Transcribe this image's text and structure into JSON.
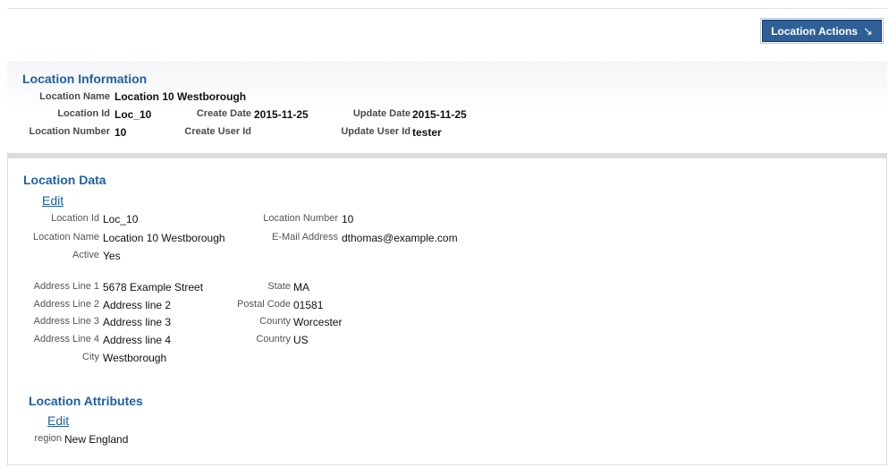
{
  "actions": {
    "label": "Location Actions",
    "icon": "arrow-down-right-icon"
  },
  "info": {
    "title": "Location Information",
    "location_name_label": "Location Name",
    "location_name": "Location 10 Westborough",
    "location_id_label": "Location Id",
    "location_id": "Loc_10",
    "create_date_label": "Create Date",
    "create_date": "2015-11-25",
    "update_date_label": "Update Date",
    "update_date": "2015-11-25",
    "location_number_label": "Location Number",
    "location_number": "10",
    "create_user_label": "Create User Id",
    "create_user": "",
    "update_user_label": "Update User Id",
    "update_user": "tester"
  },
  "data": {
    "title": "Location Data",
    "edit_label": "Edit",
    "fields": {
      "location_id": {
        "label": "Location Id",
        "value": "Loc_10"
      },
      "location_name": {
        "label": "Location Name",
        "value": "Location 10 Westborough"
      },
      "active": {
        "label": "Active",
        "value": "Yes"
      },
      "location_number": {
        "label": "Location Number",
        "value": "10"
      },
      "email": {
        "label": "E-Mail Address",
        "value": "dthomas@example.com"
      },
      "address1": {
        "label": "Address Line 1",
        "value": "5678 Example Street"
      },
      "address2": {
        "label": "Address Line 2",
        "value": "Address line 2"
      },
      "address3": {
        "label": "Address Line 3",
        "value": "Address line 3"
      },
      "address4": {
        "label": "Address Line 4",
        "value": "Address line 4"
      },
      "city": {
        "label": "City",
        "value": "Westborough"
      },
      "state": {
        "label": "State",
        "value": "MA"
      },
      "postal": {
        "label": "Postal Code",
        "value": "01581"
      },
      "county": {
        "label": "County",
        "value": "Worcester"
      },
      "country": {
        "label": "Country",
        "value": "US"
      }
    }
  },
  "attributes": {
    "title": "Location Attributes",
    "edit_label": "Edit",
    "region_label": "region",
    "region_value": "New England"
  },
  "colors": {
    "accent": "#1f5fa5",
    "button_bg": "#2f5f97"
  }
}
